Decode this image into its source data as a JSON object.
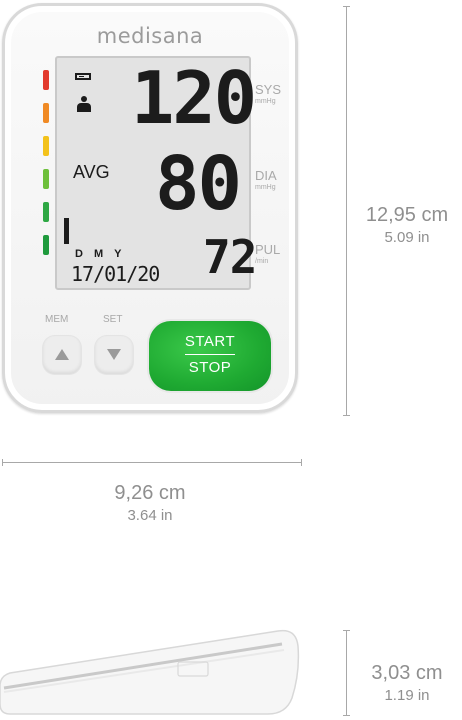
{
  "device": {
    "brand": "medisana",
    "display": {
      "systolic": "120",
      "diastolic": "80",
      "pulse": "72",
      "avg_label": "AVG",
      "date_labels": "DMY",
      "date_value": "17/01/20",
      "sys_label": "SYS",
      "sys_unit": "mmHg",
      "dia_label": "DIA",
      "dia_unit": "mmHg",
      "pul_label": "PUL",
      "pul_unit": "/min"
    },
    "scale_colors": [
      "#e23a2d",
      "#f08a24",
      "#f3c21b",
      "#6dbf3a",
      "#2ea844",
      "#1e9a3c"
    ],
    "buttons": {
      "mem_label": "MEM",
      "set_label": "SET",
      "start_label": "START",
      "stop_label": "STOP"
    },
    "accent_color": "#1faa32"
  },
  "dimensions": {
    "height_cm": "12,95 cm",
    "height_in": "5.09 in",
    "width_cm": "9,26 cm",
    "width_in": "3.64 in",
    "depth_cm": "3,03 cm",
    "depth_in": "1.19 in"
  }
}
